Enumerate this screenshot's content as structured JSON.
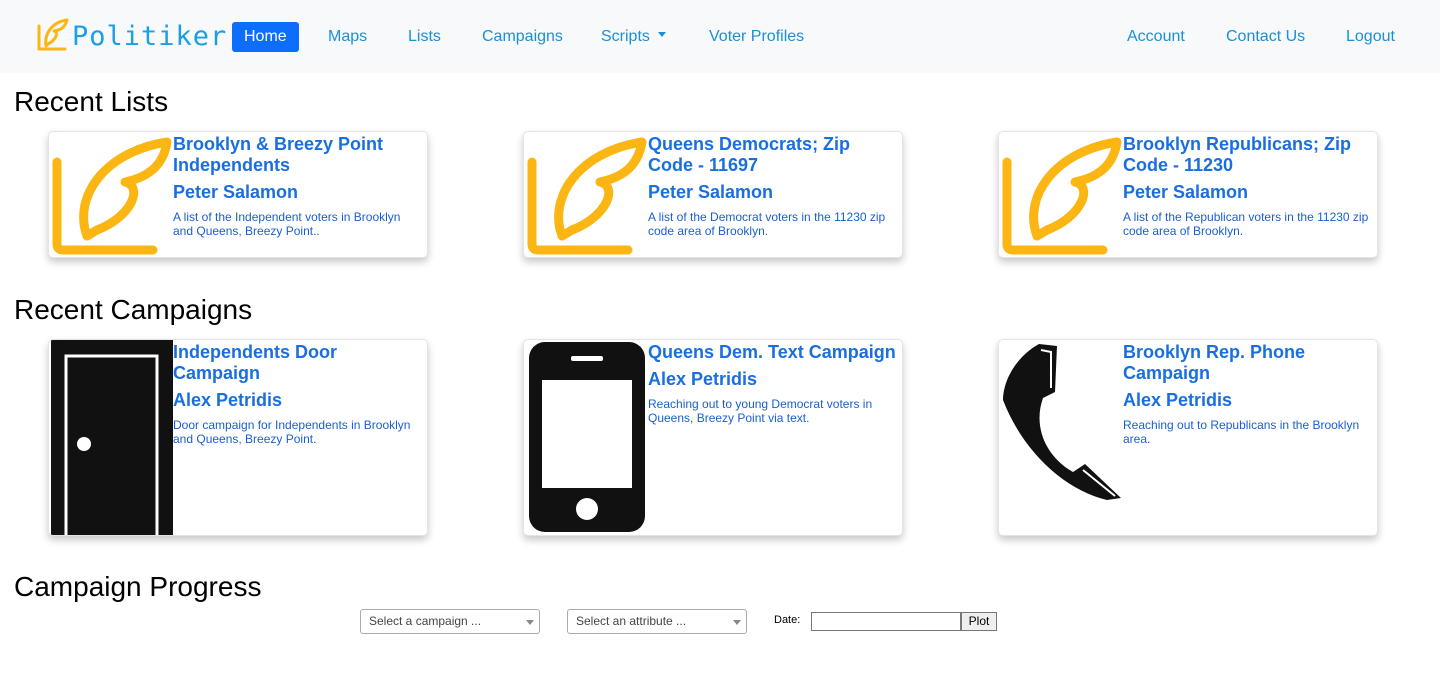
{
  "brand": {
    "name": "Politiker",
    "logo_icon": "quill-icon"
  },
  "nav": {
    "home": "Home",
    "maps": "Maps",
    "lists": "Lists",
    "campaigns": "Campaigns",
    "scripts": "Scripts",
    "voter_profiles": "Voter Profiles",
    "account": "Account",
    "contact_us": "Contact Us",
    "logout": "Logout"
  },
  "recent_lists": {
    "heading": "Recent Lists",
    "items": [
      {
        "title": "Brooklyn & Breezy Point Independents",
        "author": "Peter Salamon",
        "description": "A list of the Independent voters in Brooklyn and Queens, Breezy Point..",
        "icon": "quill-icon"
      },
      {
        "title": "Queens Democrats; Zip Code - 11697",
        "author": "Peter Salamon",
        "description": "A list of the Democrat voters in the 11230 zip code area of Brooklyn.",
        "icon": "quill-icon"
      },
      {
        "title": "Brooklyn Republicans; Zip Code - 11230",
        "author": "Peter Salamon",
        "description": "A list of the Republican voters in the 11230 zip code area of Brooklyn.",
        "icon": "quill-icon"
      }
    ]
  },
  "recent_campaigns": {
    "heading": "Recent Campaigns",
    "items": [
      {
        "title": "Independents Door Campaign",
        "author": "Alex Petridis",
        "description": "Door campaign for Independents in Brooklyn and Queens, Breezy Point.",
        "icon": "door-icon"
      },
      {
        "title": "Queens Dem. Text Campaign",
        "author": "Alex Petridis",
        "description": "Reaching out to young Democrat voters in Queens, Breezy Point via text.",
        "icon": "mobile-phone-icon"
      },
      {
        "title": "Brooklyn Rep. Phone Campaign",
        "author": "Alex Petridis",
        "description": "Reaching out to Republicans in the Brooklyn area.",
        "icon": "telephone-handset-icon"
      }
    ]
  },
  "campaign_progress": {
    "heading": "Campaign Progress",
    "campaign_select": "Select a campaign ...",
    "attribute_select": "Select an attribute ...",
    "date_label": "Date:",
    "date_value": "",
    "plot_button": "Plot"
  },
  "colors": {
    "link": "#1a8fd9",
    "active_nav": "#0d6efd",
    "card_title": "#1a6fe0",
    "quill": "#fbb614",
    "navbar_bg": "#f8f9fa"
  }
}
